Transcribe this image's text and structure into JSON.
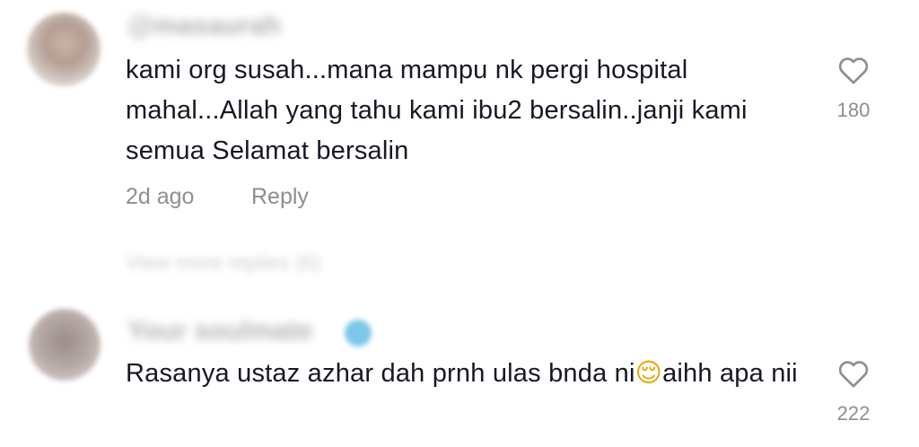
{
  "comments": [
    {
      "username": "@masaurah",
      "text": "kami org susah...mana mampu nk pergi hospital mahal...Allah yang tahu kami ibu2 bersalin..janji kami semua Selamat bersalin",
      "timestamp": "2d ago",
      "reply_label": "Reply",
      "like_count": "180",
      "view_replies": "View more replies (6)"
    },
    {
      "username": "Your soulmate",
      "text_part1": "Rasanya ustaz azhar dah prnh ulas bnda ni",
      "emoji": "😌",
      "text_part2": "aihh apa nii",
      "like_count": "222"
    }
  ],
  "icons": {
    "like": "heart-outline-icon",
    "verified": "verified-badge-icon"
  },
  "colors": {
    "text": "#161823",
    "meta": "#8e8e93",
    "verified": "#7cc7ea"
  }
}
